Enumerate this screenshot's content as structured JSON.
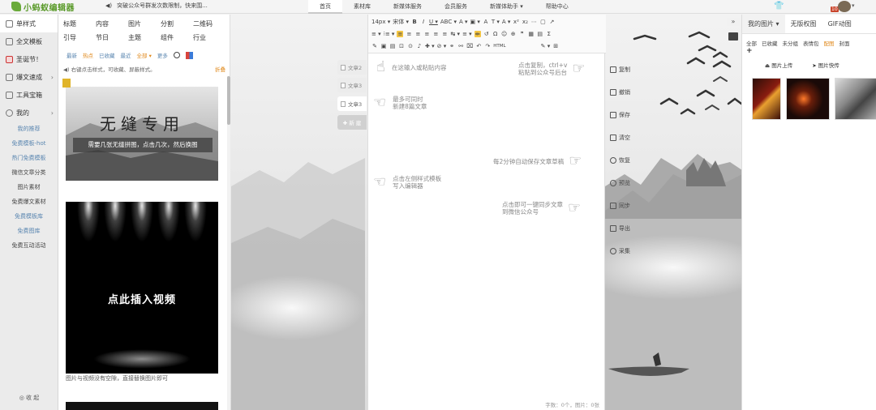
{
  "topbar": {
    "logo": "小蚂蚁编辑器",
    "announce": "突破公众号群发次数限制，快来围...",
    "nav": [
      "首页",
      "素材库",
      "新媒体服务",
      "会员服务",
      "新媒体助手 ▾",
      "帮助中心"
    ],
    "level_badge": "10"
  },
  "leftnav": {
    "items": [
      {
        "label": "单样式",
        "arrow": ""
      },
      {
        "label": "全文模板",
        "arrow": ""
      },
      {
        "label": "圣诞节！",
        "arrow": ""
      },
      {
        "label": "爆文速成",
        "arrow": "›"
      },
      {
        "label": "工具宝箱",
        "arrow": ""
      },
      {
        "label": "我的",
        "arrow": "›"
      }
    ],
    "subs": [
      {
        "label": "我的推荐",
        "blue": true
      },
      {
        "label": "免费模板-hot",
        "blue": true
      },
      {
        "label": "热门免费模板",
        "blue": true
      },
      {
        "label": "微信文章分类",
        "blue": false
      },
      {
        "label": "图片素材",
        "blue": false
      },
      {
        "label": "免费爆文素材",
        "blue": false
      },
      {
        "label": "免费模板库",
        "blue": true
      },
      {
        "label": "免费图库",
        "blue": true
      },
      {
        "label": "免费互动活动",
        "blue": false
      }
    ],
    "collapse": "收 起"
  },
  "stylepanel": {
    "categories": [
      "标题",
      "内容",
      "图片",
      "分割",
      "二维码",
      "引导",
      "节日",
      "主题",
      "组件",
      "行业"
    ],
    "filters": [
      {
        "label": "最新",
        "orange": false
      },
      {
        "label": "热点",
        "orange": true
      },
      {
        "label": "已收藏",
        "orange": false
      },
      {
        "label": "最近",
        "orange": false
      },
      {
        "label": "全部 ▾",
        "orange": true
      },
      {
        "label": "更多",
        "orange": false
      }
    ],
    "tip": "◀) 右键点击样式，可收藏、屏蔽样式。",
    "fold": "折叠",
    "card1_title": "无缝专用",
    "card1_sub": "需要几张无缝拼图，点击几次，然后换图",
    "card2_title": "点此插入视频",
    "card2_caption": "图片与视频没有空隙，直接替换图片即可"
  },
  "doctabs": [
    "文章2",
    "文章3",
    "文章3"
  ],
  "newdoc": "✚ 新 建",
  "editor": {
    "toolbar_row1": [
      "14px ▾",
      "宋体 ▾",
      "B",
      "I",
      "U ▾",
      "ABC ▾",
      "A ▾",
      "▣ ▾",
      "A",
      "T ▾",
      "A ▾",
      "x²",
      "x₂",
      "⋯",
      "▢",
      "↗"
    ],
    "toolbar_row2": [
      "≡ ▾",
      "⁝≡ ▾",
      "≡",
      "≡",
      "≡",
      "≡",
      "≡",
      "≡",
      "↹ ▾",
      "≡ ▾",
      "⇹",
      "↺",
      "Ω",
      "☺",
      "⊕",
      "❞",
      "▦",
      "▤",
      "Σ"
    ],
    "toolbar_row3": [
      "✎",
      "▣",
      "▤",
      "⊡",
      "⊙",
      "♪",
      "✚ ▾",
      "⊘ ▾",
      "⚭",
      "⚯",
      "⌧",
      "↶",
      "↷",
      "HTML",
      "✎ ▾",
      "⊞"
    ],
    "hints": [
      "在这输入或粘贴内容",
      "点击复制，ctrl+v\n粘贴到公众号后台",
      "最多可同时\n新建8篇文章",
      "每2分钟自动保存文章草稿",
      "点击左侧样式模板\n写入编辑器",
      "点击即可一键同步文章\n到微信公众号"
    ],
    "wordcount": "字数：0个，图片：0张"
  },
  "actions": [
    "复制",
    "撤销",
    "保存",
    "清空",
    "恢复",
    "预览",
    "同步",
    "导出",
    "采集"
  ],
  "rightpanel": {
    "tabs": [
      "我的图片 ▾",
      "无版权图",
      "GIF动图"
    ],
    "subtabs": [
      {
        "label": "全部",
        "orange": false
      },
      {
        "label": "已收藏",
        "orange": false
      },
      {
        "label": "未分组",
        "orange": false
      },
      {
        "label": "表情包",
        "orange": false
      },
      {
        "label": "配图",
        "orange": true
      },
      {
        "label": "封面",
        "orange": false
      }
    ],
    "upload": "图片上传",
    "fetch": "图片快传",
    "expand": "»"
  }
}
